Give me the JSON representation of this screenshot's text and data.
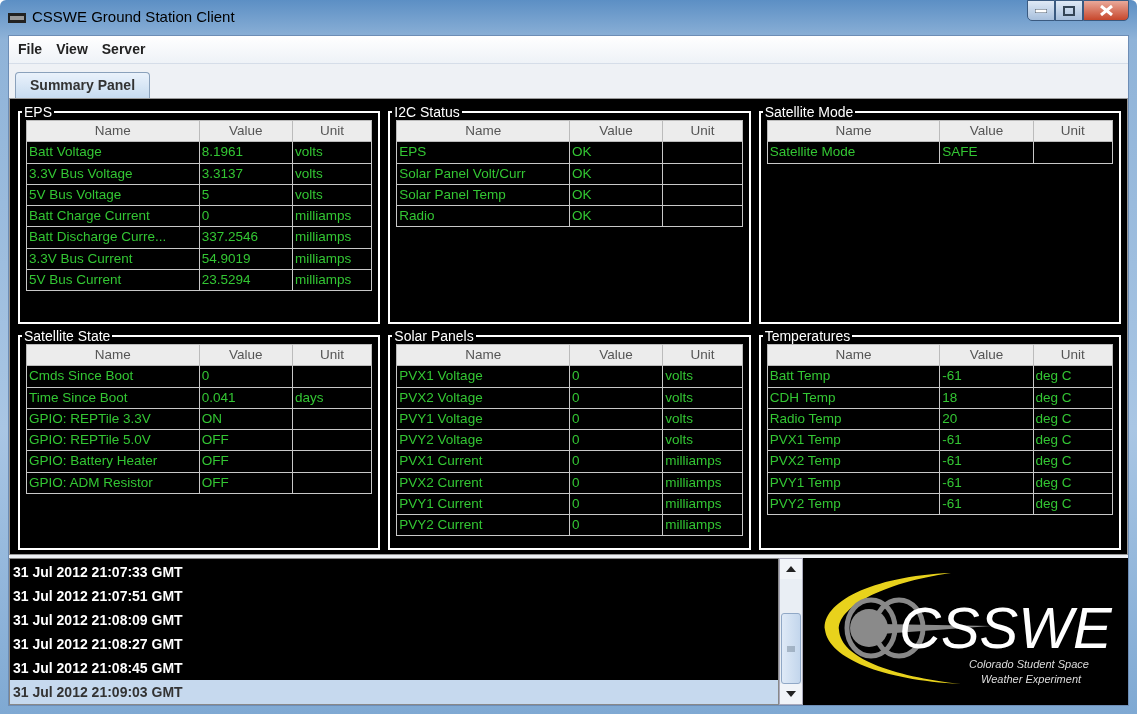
{
  "window": {
    "title": "CSSWE Ground Station Client"
  },
  "menu": [
    "File",
    "View",
    "Server"
  ],
  "tabs": [
    {
      "label": "Summary Panel",
      "selected": true
    }
  ],
  "panels": [
    {
      "title": "EPS",
      "columns": [
        "Name",
        "Value",
        "Unit"
      ],
      "rows": [
        {
          "name": "Batt Voltage",
          "value": "8.1961",
          "unit": "volts"
        },
        {
          "name": "3.3V Bus Voltage",
          "value": "3.3137",
          "unit": "volts"
        },
        {
          "name": "5V Bus Voltage",
          "value": "5",
          "unit": "volts"
        },
        {
          "name": "Batt Charge Current",
          "value": "0",
          "unit": "milliamps"
        },
        {
          "name": "Batt Discharge Curre...",
          "value": "337.2546",
          "unit": "milliamps"
        },
        {
          "name": "3.3V Bus Current",
          "value": "54.9019",
          "unit": "milliamps"
        },
        {
          "name": "5V Bus Current",
          "value": "23.5294",
          "unit": "milliamps"
        }
      ]
    },
    {
      "title": "I2C Status",
      "columns": [
        "Name",
        "Value",
        "Unit"
      ],
      "rows": [
        {
          "name": "EPS",
          "value": "OK"
        },
        {
          "name": "Solar Panel Volt/Curr",
          "value": "OK"
        },
        {
          "name": "Solar Panel Temp",
          "value": "OK"
        },
        {
          "name": "Radio",
          "value": "OK"
        }
      ]
    },
    {
      "title": "Satellite Mode",
      "columns": [
        "Name",
        "Value",
        "Unit"
      ],
      "rows": [
        {
          "name": "Satellite Mode",
          "value": "SAFE"
        }
      ]
    },
    {
      "title": "Satellite State",
      "columns": [
        "Name",
        "Value",
        "Unit"
      ],
      "rows": [
        {
          "name": "Cmds Since Boot",
          "value": "0"
        },
        {
          "name": "Time Since Boot",
          "value": "0.041",
          "unit": "days"
        },
        {
          "name": "GPIO: REPTile 3.3V",
          "value": "ON"
        },
        {
          "name": "GPIO: REPTile 5.0V",
          "value": "OFF"
        },
        {
          "name": "GPIO: Battery Heater",
          "value": "OFF"
        },
        {
          "name": "GPIO: ADM Resistor",
          "value": "OFF"
        }
      ]
    },
    {
      "title": "Solar Panels",
      "columns": [
        "Name",
        "Value",
        "Unit"
      ],
      "rows": [
        {
          "name": "PVX1 Voltage",
          "value": "0",
          "unit": "volts"
        },
        {
          "name": "PVX2 Voltage",
          "value": "0",
          "unit": "volts"
        },
        {
          "name": "PVY1 Voltage",
          "value": "0",
          "unit": "volts"
        },
        {
          "name": "PVY2 Voltage",
          "value": "0",
          "unit": "volts"
        },
        {
          "name": "PVX1 Current",
          "value": "0",
          "unit": "milliamps"
        },
        {
          "name": "PVX2 Current",
          "value": "0",
          "unit": "milliamps"
        },
        {
          "name": "PVY1 Current",
          "value": "0",
          "unit": "milliamps"
        },
        {
          "name": "PVY2 Current",
          "value": "0",
          "unit": "milliamps"
        }
      ]
    },
    {
      "title": "Temperatures",
      "columns": [
        "Name",
        "Value",
        "Unit"
      ],
      "rows": [
        {
          "name": "Batt Temp",
          "value": "-61",
          "unit": "deg C"
        },
        {
          "name": "CDH Temp",
          "value": "18",
          "unit": "deg C"
        },
        {
          "name": "Radio Temp",
          "value": "20",
          "unit": "deg C"
        },
        {
          "name": "PVX1 Temp",
          "value": "-61",
          "unit": "deg C"
        },
        {
          "name": "PVX2 Temp",
          "value": "-61",
          "unit": "deg C"
        },
        {
          "name": "PVY1 Temp",
          "value": "-61",
          "unit": "deg C"
        },
        {
          "name": "PVY2 Temp",
          "value": "-61",
          "unit": "deg C"
        }
      ]
    }
  ],
  "log": [
    {
      "text": "31 Jul 2012 21:07:33 GMT",
      "selected": false
    },
    {
      "text": "31 Jul 2012 21:07:51 GMT",
      "selected": false
    },
    {
      "text": "31 Jul 2012 21:08:09 GMT",
      "selected": false
    },
    {
      "text": "31 Jul 2012 21:08:27 GMT",
      "selected": false
    },
    {
      "text": "31 Jul 2012 21:08:45 GMT",
      "selected": false
    },
    {
      "text": "31 Jul 2012 21:09:03 GMT",
      "selected": true
    }
  ],
  "logo": {
    "wordmark": "CSSWE",
    "tagline": [
      "Colorado Student Space",
      "Weather Experiment"
    ]
  }
}
